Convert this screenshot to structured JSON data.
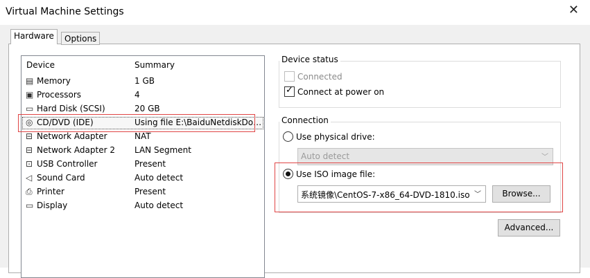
{
  "window": {
    "title": "Virtual Machine Settings",
    "close_glyph": "✕"
  },
  "tabs": [
    {
      "label": "Hardware"
    },
    {
      "label": "Options"
    }
  ],
  "device_list": {
    "columns": {
      "device": "Device",
      "summary": "Summary"
    },
    "rows": [
      {
        "icon": "memory-icon",
        "device": "Memory",
        "summary": "1 GB"
      },
      {
        "icon": "processor-icon",
        "device": "Processors",
        "summary": "4"
      },
      {
        "icon": "hard-disk-icon",
        "device": "Hard Disk (SCSI)",
        "summary": "20 GB"
      },
      {
        "icon": "cd-dvd-icon",
        "device": "CD/DVD (IDE)",
        "summary": "Using file E:\\BaiduNetdiskDo…"
      },
      {
        "icon": "network-icon",
        "device": "Network Adapter",
        "summary": "NAT"
      },
      {
        "icon": "network-icon",
        "device": "Network Adapter 2",
        "summary": "LAN Segment"
      },
      {
        "icon": "usb-icon",
        "device": "USB Controller",
        "summary": "Present"
      },
      {
        "icon": "sound-icon",
        "device": "Sound Card",
        "summary": "Auto detect"
      },
      {
        "icon": "printer-icon",
        "device": "Printer",
        "summary": "Present"
      },
      {
        "icon": "display-icon",
        "device": "Display",
        "summary": "Auto detect"
      }
    ],
    "selected_index": 3
  },
  "device_status": {
    "title": "Device status",
    "connected_label": "Connected",
    "connected_checked": false,
    "connect_power_label": "Connect at power on",
    "connect_power_checked": true
  },
  "connection": {
    "title": "Connection",
    "physical_label": "Use physical drive:",
    "physical_value": "Auto detect",
    "iso_label": "Use ISO image file:",
    "iso_value": "系统镜像\\CentOS-7-x86_64-DVD-1810.iso",
    "selected": "iso"
  },
  "buttons": {
    "browse": "Browse...",
    "advanced": "Advanced..."
  }
}
